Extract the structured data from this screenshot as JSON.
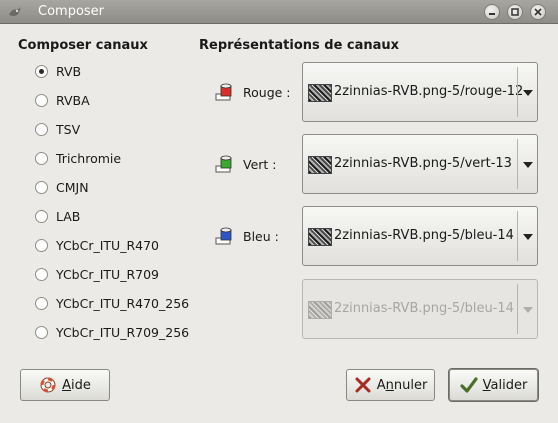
{
  "window": {
    "title": "Composer"
  },
  "left": {
    "heading": "Composer canaux",
    "options": [
      {
        "label": "RVB",
        "checked": true
      },
      {
        "label": "RVBA",
        "checked": false
      },
      {
        "label": "TSV",
        "checked": false
      },
      {
        "label": "Trichromie",
        "checked": false
      },
      {
        "label": "CMJN",
        "checked": false
      },
      {
        "label": "LAB",
        "checked": false
      },
      {
        "label": "YCbCr_ITU_R470",
        "checked": false
      },
      {
        "label": "YCbCr_ITU_R709",
        "checked": false
      },
      {
        "label": "YCbCr_ITU_R470_256",
        "checked": false
      },
      {
        "label": "YCbCr_ITU_R709_256",
        "checked": false
      }
    ]
  },
  "right": {
    "heading": "Représentations de canaux",
    "channels": [
      {
        "label": "Rouge :",
        "color": "#d8302a",
        "value": "2zinnias-RVB.png-5/rouge-12"
      },
      {
        "label": "Vert :",
        "color": "#3aa832",
        "value": "2zinnias-RVB.png-5/vert-13"
      },
      {
        "label": "Bleu :",
        "color": "#2e55c8",
        "value": "2zinnias-RVB.png-5/bleu-14"
      }
    ],
    "disabled_value": "2zinnias-RVB.png-5/bleu-14"
  },
  "buttons": {
    "help_mnemonic": "A",
    "help_rest": "ide",
    "cancel_pre": "A",
    "cancel_mnemonic": "n",
    "cancel_rest": "nuler",
    "ok_mnemonic": "V",
    "ok_rest": "alider"
  },
  "icons": {
    "app": "wilber-icon",
    "minimize": "minimize-icon",
    "maximize": "maximize-icon",
    "close": "close-icon",
    "channel": "channel-cylinder-icon",
    "help": "lifebuoy-icon",
    "cancel": "x-icon",
    "ok": "checkmark-icon"
  }
}
